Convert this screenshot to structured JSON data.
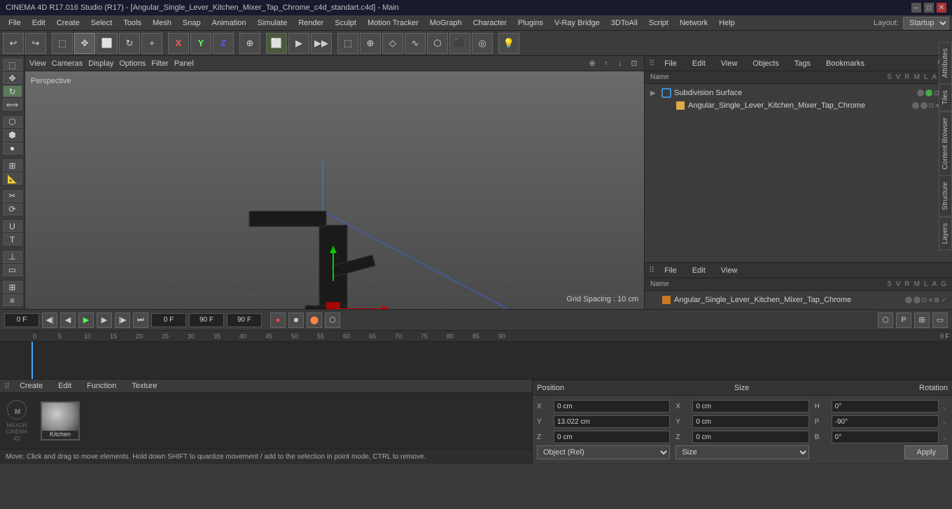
{
  "titlebar": {
    "title": "CINEMA 4D R17.016 Studio (R17) - [Angular_Single_Lever_Kitchen_Mixer_Tap_Chrome_c4d_standart.c4d] - Main"
  },
  "menubar": {
    "items": [
      "File",
      "Edit",
      "Create",
      "Select",
      "Tools",
      "Mesh",
      "Snap",
      "Animation",
      "Simulate",
      "Render",
      "Sculpt",
      "Motion Tracker",
      "MoGraph",
      "Character",
      "Plugins",
      "V-Ray Bridge",
      "3DToAll",
      "Script",
      "Network",
      "Plugins",
      "Help"
    ],
    "layout_label": "Layout:",
    "layout_value": "Startup"
  },
  "viewport": {
    "label": "Perspective",
    "grid_spacing": "Grid Spacing : 10 cm",
    "toolbar": [
      "View",
      "Cameras",
      "Display",
      "Options",
      "Filter",
      "Panel"
    ]
  },
  "objects_panel": {
    "tabs": [
      "File",
      "Edit",
      "View",
      "Objects",
      "Tags",
      "Bookmarks"
    ],
    "col_headers": {
      "name": "Name",
      "flags": [
        "S",
        "V",
        "R",
        "M",
        "L",
        "A",
        "G"
      ]
    },
    "items": [
      {
        "label": "Subdivision Surface",
        "icon": "green",
        "indent": 0,
        "selected": false,
        "flags": []
      },
      {
        "label": "Angular_Single_Lever_Kitchen_Mixer_Tap_Chrome",
        "icon": "yellow",
        "indent": 1,
        "selected": false,
        "flags": []
      }
    ]
  },
  "attributes_panel": {
    "tabs": [
      "File",
      "Edit",
      "View"
    ],
    "col_headers": {
      "name": "Name",
      "flags": [
        "S",
        "V",
        "R",
        "M",
        "L",
        "A",
        "G"
      ]
    },
    "items": [
      {
        "label": "Angular_Single_Lever_Kitchen_Mixer_Tap_Chrome",
        "icon": "orange",
        "indent": 0,
        "selected": false
      }
    ]
  },
  "timeline": {
    "frame_start": "0 F",
    "frame_current": "0 F",
    "frame_end": "90 F",
    "frame_preview_end": "90 F",
    "ticks": [
      0,
      5,
      10,
      15,
      20,
      25,
      30,
      35,
      40,
      45,
      50,
      55,
      60,
      65,
      70,
      75,
      80,
      85,
      90
    ]
  },
  "properties": {
    "position_label": "Position",
    "size_label": "Size",
    "rotation_label": "Rotation",
    "x_pos": "0 cm",
    "y_pos": "13.022 cm",
    "z_pos": "0 cm",
    "x_size": "0 cm",
    "y_size": "0 cm",
    "z_size": "0 cm",
    "h_rot": "0°",
    "p_rot": "-90°",
    "b_rot": "0°",
    "coord_mode": "Object (Rel)",
    "size_mode": "Size",
    "apply_label": "Apply"
  },
  "material": {
    "tabs": [
      "Create",
      "Edit",
      "Function",
      "Texture"
    ],
    "items": [
      {
        "label": "Kitchen",
        "color": "#8a7a6a"
      }
    ]
  },
  "statusbar": {
    "text": "Move: Click and drag to move elements. Hold down SHIFT to quantize movement / add to the selection in point mode, CTRL to remove."
  },
  "side_tabs": [
    "Attributes",
    "Content Browser",
    "Structure",
    "Layers"
  ],
  "icons": {
    "undo": "↩",
    "redo": "↪",
    "move": "✥",
    "scale": "⟺",
    "rotate": "↻",
    "new": "+",
    "x_axis": "X",
    "y_axis": "Y",
    "z_axis": "Z",
    "world": "W",
    "play": "▶",
    "stop": "■",
    "prev": "◀",
    "next": "▶",
    "first": "⏮",
    "last": "⏭",
    "record": "●",
    "light": "💡"
  }
}
